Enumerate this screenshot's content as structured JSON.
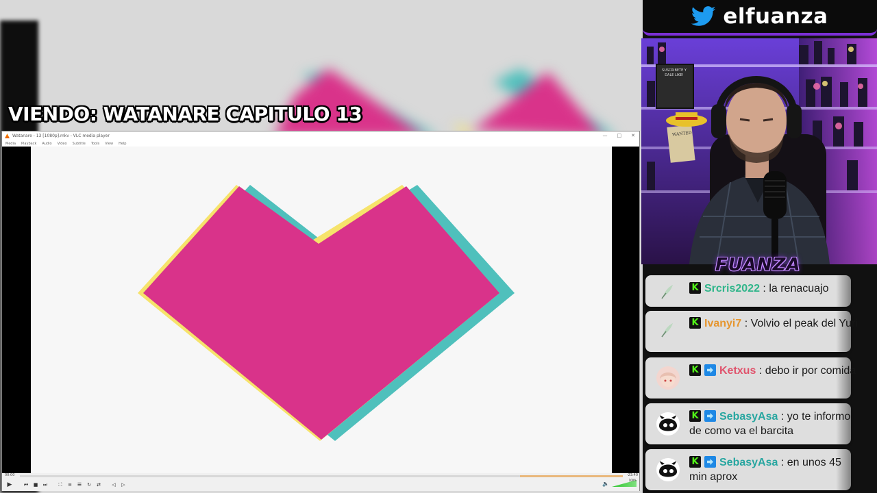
{
  "overlay": {
    "viewing_title": "VIENDO: WATANARE CAPITULO 13",
    "twitter_handle": "elfuanza",
    "brand_logo": "FUANZA"
  },
  "webcam": {
    "poster_suscribete": "SUSCRIBETE Y DALE LIKE!",
    "poster_wanted": "WANTED"
  },
  "vlc": {
    "window_title": "Watanare - 13 [1080p].mkv - VLC media player",
    "menu": [
      "Media",
      "Playback",
      "Audio",
      "Video",
      "Subtitle",
      "Tools",
      "View",
      "Help"
    ],
    "time_elapsed": "00:00",
    "time_remaining": "-23:40",
    "volume_pct": "100%",
    "seek_progress": 0.0,
    "controls": [
      "play-icon",
      "prev-icon",
      "stop-icon",
      "next-icon",
      "fullscreen-icon",
      "extended-settings-icon",
      "playlist-icon",
      "loop-icon",
      "shuffle-icon",
      "frame-back-icon",
      "frame-forward-icon"
    ]
  },
  "chat": {
    "messages": [
      {
        "user": "Srcris2022",
        "text": "la renacuajo",
        "color": "#2fb58a",
        "badges": [
          "kick"
        ]
      },
      {
        "user": "Ivanyi7",
        "text": "Volvio el peak del Yuri",
        "color": "#e6962f",
        "badges": [
          "kick"
        ]
      },
      {
        "user": "Ketxus",
        "text": "debo ir por comida",
        "color": "#e0536c",
        "badges": [
          "kick",
          "sub"
        ]
      },
      {
        "user": "SebasyAsa",
        "text": "yo te informo de como va el barcita",
        "color": "#27a6a0",
        "badges": [
          "kick",
          "sub"
        ]
      },
      {
        "user": "SebasyAsa",
        "text": "en unos 45 min aprox",
        "color": "#27a6a0",
        "badges": [
          "kick",
          "sub"
        ]
      }
    ]
  },
  "colors": {
    "heart_pink": "#d9338a",
    "heart_teal": "#4fc0bc",
    "heart_yellow": "#f6e36b",
    "accent_purple": "#7b2fd6",
    "kick_green": "#53fc18"
  }
}
